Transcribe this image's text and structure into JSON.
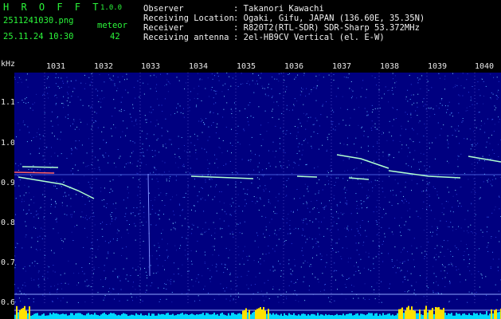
{
  "app": {
    "title": "H R O F F T",
    "version": "1.0.0"
  },
  "file": {
    "name": "2511241030.png",
    "timestamp": "25.11.24 10:30"
  },
  "meteor": {
    "label": "meteor",
    "count": "42"
  },
  "info": [
    {
      "key": "Observer",
      "value": ": Takanori Kawachi"
    },
    {
      "key": "Receiving Location",
      "value": ": Ogaki, Gifu, JAPAN (136.60E, 35.35N)"
    },
    {
      "key": "Receiver",
      "value": ": R820T2(RTL-SDR) SDR-Sharp 53.372MHz"
    },
    {
      "key": "Receiving antenna",
      "value": ": 2el-HB9CV Vertical (el. E-W)"
    }
  ],
  "axis": {
    "y_unit": "kHz",
    "y_ticks": [
      "1.1",
      "1.0",
      "0.9",
      "0.8",
      "0.7",
      "0.6"
    ],
    "x_ticks": [
      "1031",
      "1032",
      "1033",
      "1034",
      "1035",
      "1036",
      "1037",
      "1038",
      "1039",
      "1040"
    ]
  },
  "colors": {
    "header_green": "#2bf53a",
    "background": "#000080",
    "signal": "#b0ffd0",
    "level_fill": "#00d8ff",
    "level_peak": "#ffe000"
  }
}
